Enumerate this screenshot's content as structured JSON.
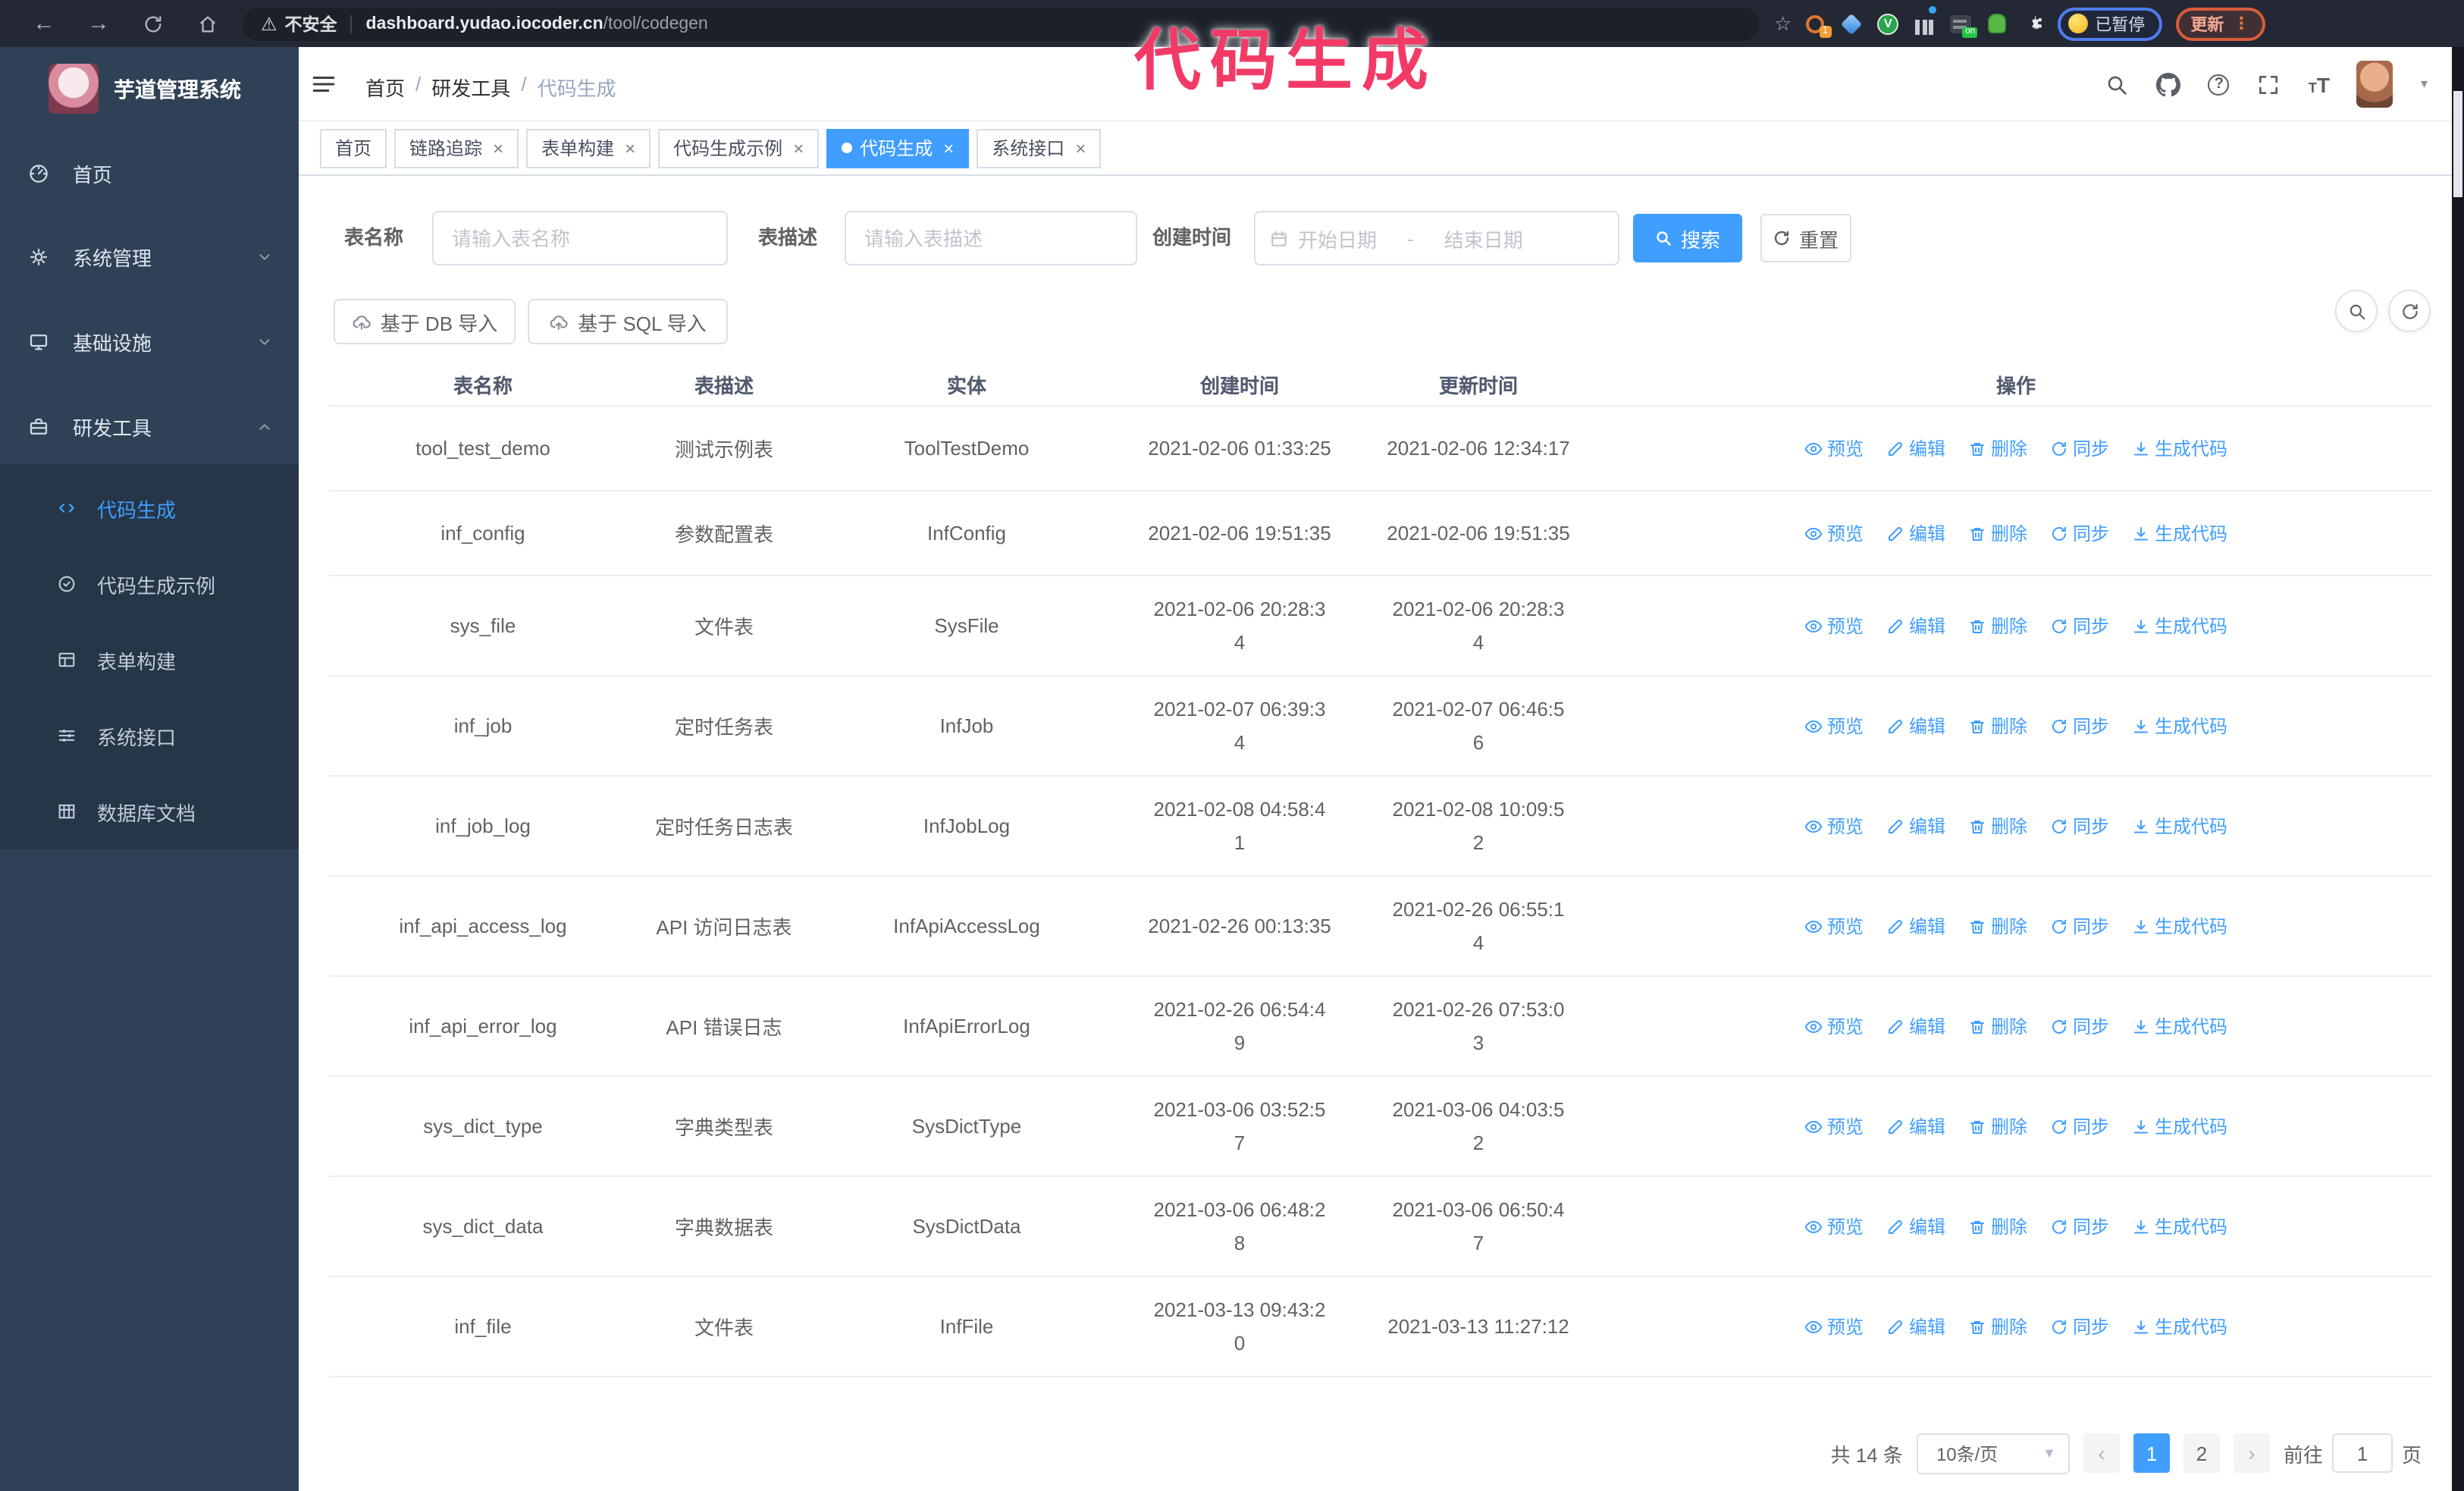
{
  "colors": {
    "accent": "#409eff",
    "sidebar_bg": "#304156",
    "annotation": "#f23a67",
    "tab_active_bg": "#409eff",
    "update_btn_border": "#d95b3b",
    "paused_pill_border": "#4e7cf0"
  },
  "annotation": {
    "text": "代码生成"
  },
  "browser": {
    "security_label": "不安全",
    "url_host": "dashboard.yudao.iocoder.cn",
    "url_path": "/tool/codegen",
    "extension_badge": "1",
    "on_badge": "on",
    "ext_v_label": "V",
    "paused_label": "已暂停",
    "update_label": "更新",
    "kebab": "⋮"
  },
  "sidebar": {
    "logo_title": "芋道管理系统",
    "items": [
      {
        "label": "首页"
      },
      {
        "label": "系统管理"
      },
      {
        "label": "基础设施"
      },
      {
        "label": "研发工具"
      }
    ],
    "subitems": [
      {
        "label": "代码生成"
      },
      {
        "label": "代码生成示例"
      },
      {
        "label": "表单构建"
      },
      {
        "label": "系统接口"
      },
      {
        "label": "数据库文档"
      }
    ]
  },
  "header": {
    "breadcrumb": [
      "首页",
      "研发工具",
      "代码生成"
    ],
    "font_icon_big": "T",
    "font_icon_small": "T",
    "help_mark": "?",
    "caret": "▾"
  },
  "tabs": [
    {
      "label": "首页",
      "closable": false,
      "active": false
    },
    {
      "label": "链路追踪",
      "closable": true,
      "active": false
    },
    {
      "label": "表单构建",
      "closable": true,
      "active": false
    },
    {
      "label": "代码生成示例",
      "closable": true,
      "active": false
    },
    {
      "label": "代码生成",
      "closable": true,
      "active": true
    },
    {
      "label": "系统接口",
      "closable": true,
      "active": false
    }
  ],
  "close_glyph": "×",
  "filters": {
    "name_label": "表名称",
    "name_placeholder": "请输入表名称",
    "desc_label": "表描述",
    "desc_placeholder": "请输入表描述",
    "time_label": "创建时间",
    "start_placeholder": "开始日期",
    "range_separator": "-",
    "end_placeholder": "结束日期",
    "search_label": "搜索",
    "reset_label": "重置"
  },
  "toolbar": {
    "import_db_label": "基于 DB 导入",
    "import_sql_label": "基于 SQL 导入"
  },
  "table": {
    "columns": [
      "表名称",
      "表描述",
      "实体",
      "创建时间",
      "更新时间",
      "操作"
    ],
    "action_labels": {
      "preview": "预览",
      "edit": "编辑",
      "delete": "删除",
      "sync": "同步",
      "generate": "生成代码"
    },
    "rows": [
      {
        "name": "tool_test_demo",
        "desc": "测试示例表",
        "entity": "ToolTestDemo",
        "created": "2021-02-06 01:33:25",
        "updated": "2021-02-06 12:34:17"
      },
      {
        "name": "inf_config",
        "desc": "参数配置表",
        "entity": "InfConfig",
        "created": "2021-02-06 19:51:35",
        "updated": "2021-02-06 19:51:35"
      },
      {
        "name": "sys_file",
        "desc": "文件表",
        "entity": "SysFile",
        "created": "2021-02-06 20:28:3\n4",
        "updated": "2021-02-06 20:28:3\n4"
      },
      {
        "name": "inf_job",
        "desc": "定时任务表",
        "entity": "InfJob",
        "created": "2021-02-07 06:39:3\n4",
        "updated": "2021-02-07 06:46:5\n6"
      },
      {
        "name": "inf_job_log",
        "desc": "定时任务日志表",
        "entity": "InfJobLog",
        "created": "2021-02-08 04:58:4\n1",
        "updated": "2021-02-08 10:09:5\n2"
      },
      {
        "name": "inf_api_access_log",
        "desc": "API 访问日志表",
        "entity": "InfApiAccessLog",
        "created": "2021-02-26 00:13:35",
        "updated": "2021-02-26 06:55:1\n4"
      },
      {
        "name": "inf_api_error_log",
        "desc": "API 错误日志",
        "entity": "InfApiErrorLog",
        "created": "2021-02-26 06:54:4\n9",
        "updated": "2021-02-26 07:53:0\n3"
      },
      {
        "name": "sys_dict_type",
        "desc": "字典类型表",
        "entity": "SysDictType",
        "created": "2021-03-06 03:52:5\n7",
        "updated": "2021-03-06 04:03:5\n2"
      },
      {
        "name": "sys_dict_data",
        "desc": "字典数据表",
        "entity": "SysDictData",
        "created": "2021-03-06 06:48:2\n8",
        "updated": "2021-03-06 06:50:4\n7"
      },
      {
        "name": "inf_file",
        "desc": "文件表",
        "entity": "InfFile",
        "created": "2021-03-13 09:43:2\n0",
        "updated": "2021-03-13 11:27:12"
      }
    ]
  },
  "pagination": {
    "total_label": "共 14 条",
    "page_size_label": "10条/页",
    "prev_glyph": "‹",
    "next_glyph": "›",
    "pages": [
      "1",
      "2"
    ],
    "current_page": "1",
    "goto_label": "前往",
    "goto_value": "1",
    "goto_suffix": "页"
  }
}
